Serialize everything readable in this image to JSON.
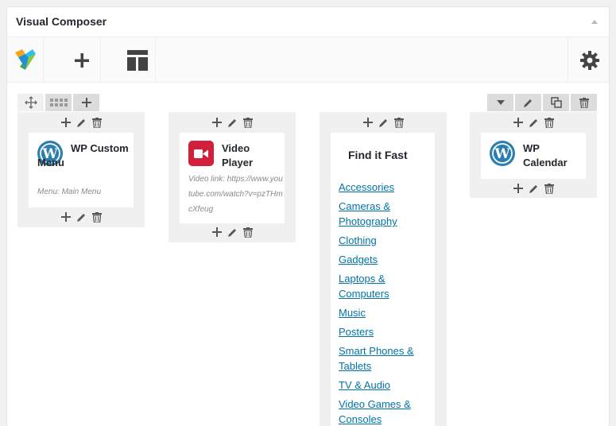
{
  "panel": {
    "title": "Visual Composer"
  },
  "toolbar": {
    "logo": "vc-logo-icon",
    "add": "plus-icon",
    "templates": "templates-icon",
    "settings": "gear-icon"
  },
  "colors": {
    "link": "#0073aa",
    "wp_blue": "#2b7eb0",
    "video_red": "#d21f3c",
    "column_bg": "#f0f0f0",
    "control_bg": "#dcdcdc"
  },
  "elements": {
    "menu": {
      "title": "WP Custom Menu",
      "subtitle": "Menu: Main Menu"
    },
    "video": {
      "title": "Video Player",
      "subtitle": "Video link: https://www.youtube.com/watch?v=pzTHmcXfeug"
    },
    "findit": {
      "title": "Find it Fast",
      "links": [
        "Accessories",
        "Cameras & Photography",
        "Clothing",
        "Gadgets",
        "Laptops & Computers",
        "Music",
        "Posters",
        "Smart Phones & Tablets",
        "TV & Audio",
        "Video Games & Consoles"
      ]
    },
    "calendar": {
      "title": "WP Calendar"
    }
  }
}
